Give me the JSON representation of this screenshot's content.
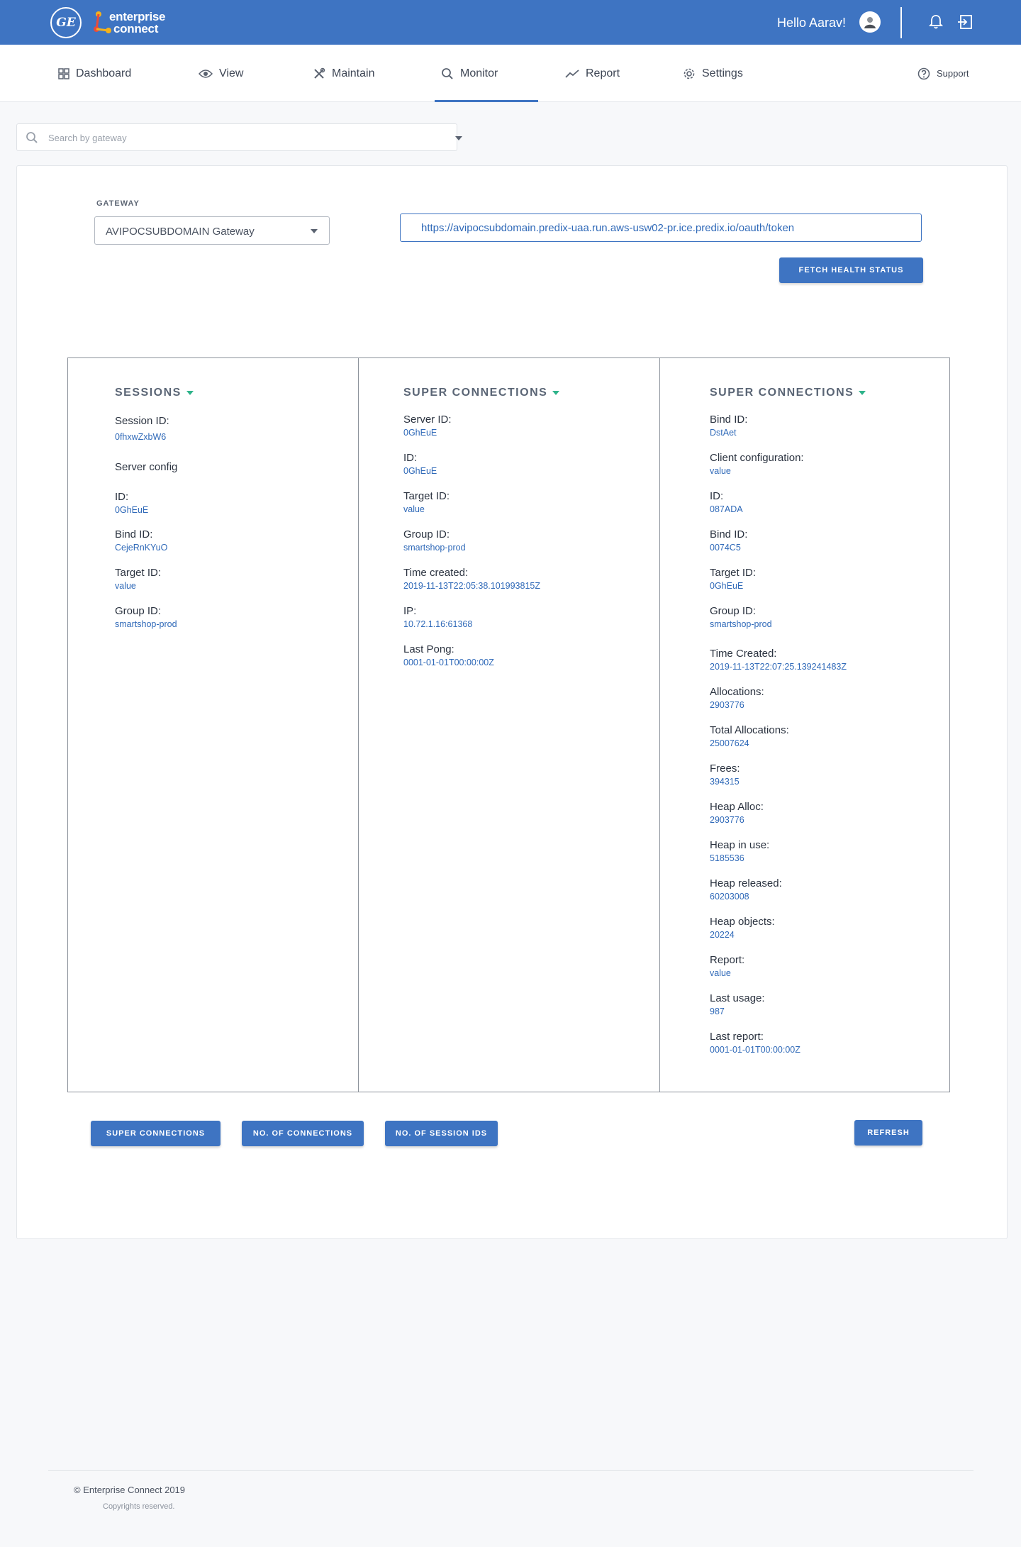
{
  "header": {
    "logo_primary": "GE",
    "logo_text_line1": "enterprise",
    "logo_text_line2": "connect",
    "greeting": "Hello Aarav!",
    "icons": [
      "ge-logo-icon",
      "user-avatar-icon",
      "bell-icon",
      "logout-icon"
    ],
    "accent_color": "#3e74c2"
  },
  "nav": {
    "items": [
      {
        "label": "Dashboard",
        "icon": "dashboard-icon"
      },
      {
        "label": "View",
        "icon": "eye-icon"
      },
      {
        "label": "Maintain",
        "icon": "tools-icon"
      },
      {
        "label": "Monitor",
        "icon": "search-icon",
        "active": true
      },
      {
        "label": "Report",
        "icon": "trend-icon"
      },
      {
        "label": "Settings",
        "icon": "gear-icon"
      }
    ],
    "support_label": "Support"
  },
  "search": {
    "placeholder": "Search by gateway",
    "value": ""
  },
  "gateway": {
    "label": "GATEWAY",
    "selected": "AVIPOCSUBDOMAIN Gateway",
    "url": "https://avipocsubdomain.predix-uaa.run.aws-usw02-pr.ice.predix.io/oauth/token",
    "fetch_button": "FETCH HEALTH STATUS"
  },
  "sessions": {
    "title": "SESSIONS",
    "session_id_label": "Session ID:",
    "session_id": "0fhxwZxbW6",
    "server_config_label": "Server config",
    "fields": [
      {
        "label": "ID:",
        "value": "0GhEuE"
      },
      {
        "label": "Bind ID:",
        "value": "CejeRnKYuO"
      },
      {
        "label": "Target ID:",
        "value": "value"
      },
      {
        "label": "Group ID:",
        "value": "smartshop-prod"
      }
    ]
  },
  "super_connections_1": {
    "title": "SUPER CONNECTIONS",
    "fields": [
      {
        "label": "Server ID:",
        "value": "0GhEuE"
      },
      {
        "label": "ID:",
        "value": "0GhEuE"
      },
      {
        "label": "Target ID:",
        "value": "value"
      },
      {
        "label": "Group ID:",
        "value": "smartshop-prod"
      },
      {
        "label": "Time created:",
        "value": "2019-11-13T22:05:38.101993815Z"
      },
      {
        "label": "IP:",
        "value": "10.72.1.16:61368"
      },
      {
        "label": "Last Pong:",
        "value": "0001-01-01T00:00:00Z"
      }
    ]
  },
  "super_connections_2": {
    "title": "SUPER CONNECTIONS",
    "fields": [
      {
        "label": "Bind ID:",
        "value": "DstAet"
      },
      {
        "label": "Client configuration:",
        "value": "value"
      },
      {
        "label": "ID:",
        "value": "087ADA"
      },
      {
        "label": "Bind ID:",
        "value": "0074C5"
      },
      {
        "label": "Target ID:",
        "value": "0GhEuE"
      },
      {
        "label": "Group ID:",
        "value": "smartshop-prod"
      },
      {
        "label": "Time Created:",
        "value": "2019-11-13T22:07:25.139241483Z"
      },
      {
        "label": "Allocations:",
        "value": "2903776"
      },
      {
        "label": "Total Allocations:",
        "value": "25007624"
      },
      {
        "label": "Frees:",
        "value": "394315"
      },
      {
        "label": "Heap Alloc:",
        "value": "2903776"
      },
      {
        "label": "Heap in use:",
        "value": "5185536"
      },
      {
        "label": "Heap released:",
        "value": "60203008"
      },
      {
        "label": "Heap objects:",
        "value": "20224"
      },
      {
        "label": "Report:",
        "value": "value"
      },
      {
        "label": "Last usage:",
        "value": "987"
      },
      {
        "label": "Last report:",
        "value": "0001-01-01T00:00:00Z"
      }
    ]
  },
  "actions": {
    "super_connections": "SUPER CONNECTIONS",
    "no_of_connections": "NO. OF CONNECTIONS",
    "no_of_session_ids": "NO. OF SESSION IDS",
    "refresh": "REFRESH"
  },
  "footer": {
    "copyright": "© Enterprise Connect 2019",
    "rights": "Copyrights reserved."
  }
}
